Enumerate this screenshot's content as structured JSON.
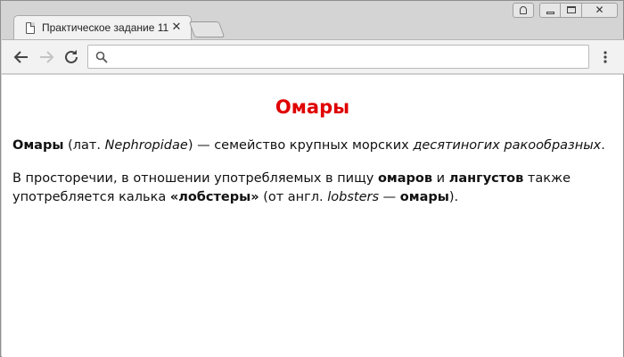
{
  "browser": {
    "tab_title": "Практическое задание 11",
    "tab_close": "✕",
    "url": ""
  },
  "page": {
    "heading": "Омары",
    "p1": {
      "omary": "Омары",
      "lat_prefix": " (лат. ",
      "nephropidae": "Nephropidae",
      "after_latin": ") — семейство крупных морских ",
      "decapods": "десятиногих ракообразных",
      "end": "."
    },
    "p2": {
      "start": "В просторечии, в отношении употребляемых в пищу ",
      "omarov": "омаров",
      "and": " и ",
      "langustov": "лангустов",
      "mid": " также употребляется калька ",
      "lobstery": "«лобстеры»",
      "ot_angl": " (от англ. ",
      "lobsters": "lobsters",
      "dash": " — ",
      "omary": "омары",
      "end": ")."
    }
  },
  "colors": {
    "heading": "#e00000",
    "text": "#111111"
  }
}
